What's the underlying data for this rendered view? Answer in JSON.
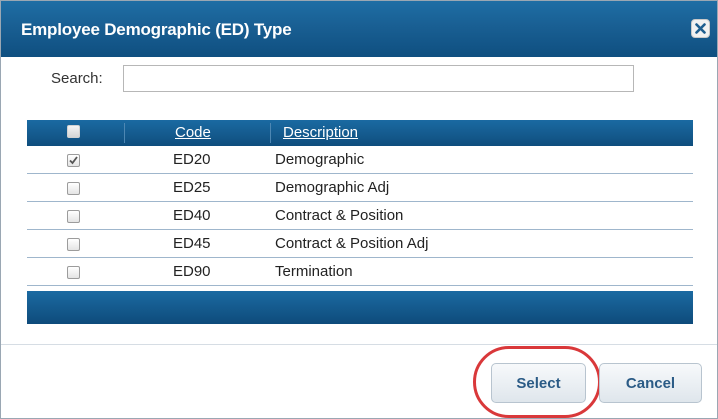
{
  "dialog": {
    "title": "Employee Demographic (ED) Type"
  },
  "search": {
    "label": "Search:",
    "value": ""
  },
  "table": {
    "columns": [
      "Code",
      "Description"
    ],
    "header_checkbox_checked": false,
    "rows": [
      {
        "checked": true,
        "code": "ED20",
        "description": "Demographic"
      },
      {
        "checked": false,
        "code": "ED25",
        "description": "Demographic Adj"
      },
      {
        "checked": false,
        "code": "ED40",
        "description": "Contract & Position"
      },
      {
        "checked": false,
        "code": "ED45",
        "description": "Contract & Position Adj"
      },
      {
        "checked": false,
        "code": "ED90",
        "description": "Termination"
      }
    ]
  },
  "buttons": {
    "select": "Select",
    "cancel": "Cancel"
  },
  "colors": {
    "titlebar": "#195f93",
    "button_text": "#2b5b86",
    "highlight": "#d9383a"
  }
}
